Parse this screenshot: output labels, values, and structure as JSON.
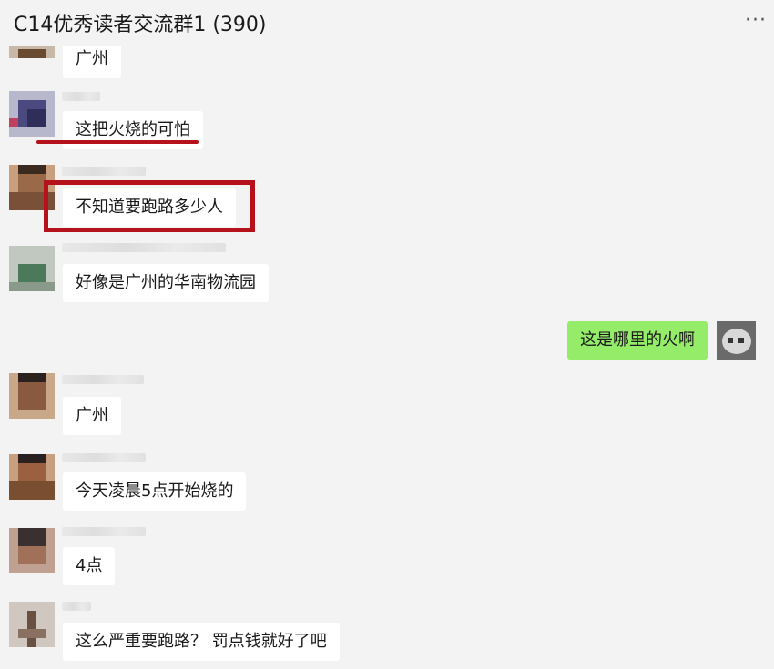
{
  "window": {
    "title": "C14优秀读者交流群1 (390)",
    "more_icon": "more-horizontal-icon"
  },
  "messages": [
    {
      "text": "广州",
      "side": "left"
    },
    {
      "text": "这把火烧的可怕",
      "side": "left"
    },
    {
      "text": "不知道要跑路多少人",
      "side": "left"
    },
    {
      "text": "好像是广州的华南物流园",
      "side": "left"
    },
    {
      "text": "这是哪里的火啊",
      "side": "right"
    },
    {
      "text": "广州",
      "side": "left"
    },
    {
      "text": "今天凌晨5点开始烧的",
      "side": "left"
    },
    {
      "text": "4点",
      "side": "left"
    },
    {
      "text": "这么严重要跑路？ 罚点钱就好了吧",
      "side": "left"
    }
  ],
  "colors": {
    "background": "#f3f3f3",
    "bubble_other": "#ffffff",
    "bubble_self": "#95ec69",
    "annotation_red": "#b5121b"
  }
}
